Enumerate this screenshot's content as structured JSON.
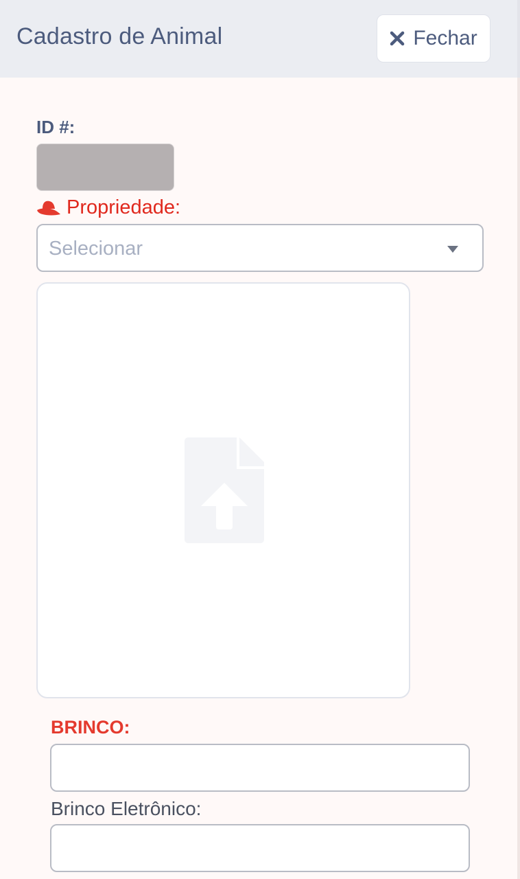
{
  "header": {
    "title": "Cadastro de Animal",
    "close_label": "Fechar"
  },
  "form": {
    "id_label": "ID #:",
    "property_label": "Propriedade:",
    "property_icon": "hat-icon",
    "property_select": {
      "placeholder": "Selecionar",
      "value": ""
    },
    "upload": {
      "icon": "file-upload-icon"
    },
    "brinco_label": "BRINCO:",
    "brinco_value": "",
    "brinco_eletronico_label": "Brinco Eletrônico:",
    "brinco_eletronico_value": ""
  },
  "colors": {
    "header_bg": "#ebedf2",
    "page_bg": "#fff9f8",
    "title_text": "#4c5b7d",
    "required_red": "#e0281d",
    "id_box": "#b5b0b1"
  }
}
